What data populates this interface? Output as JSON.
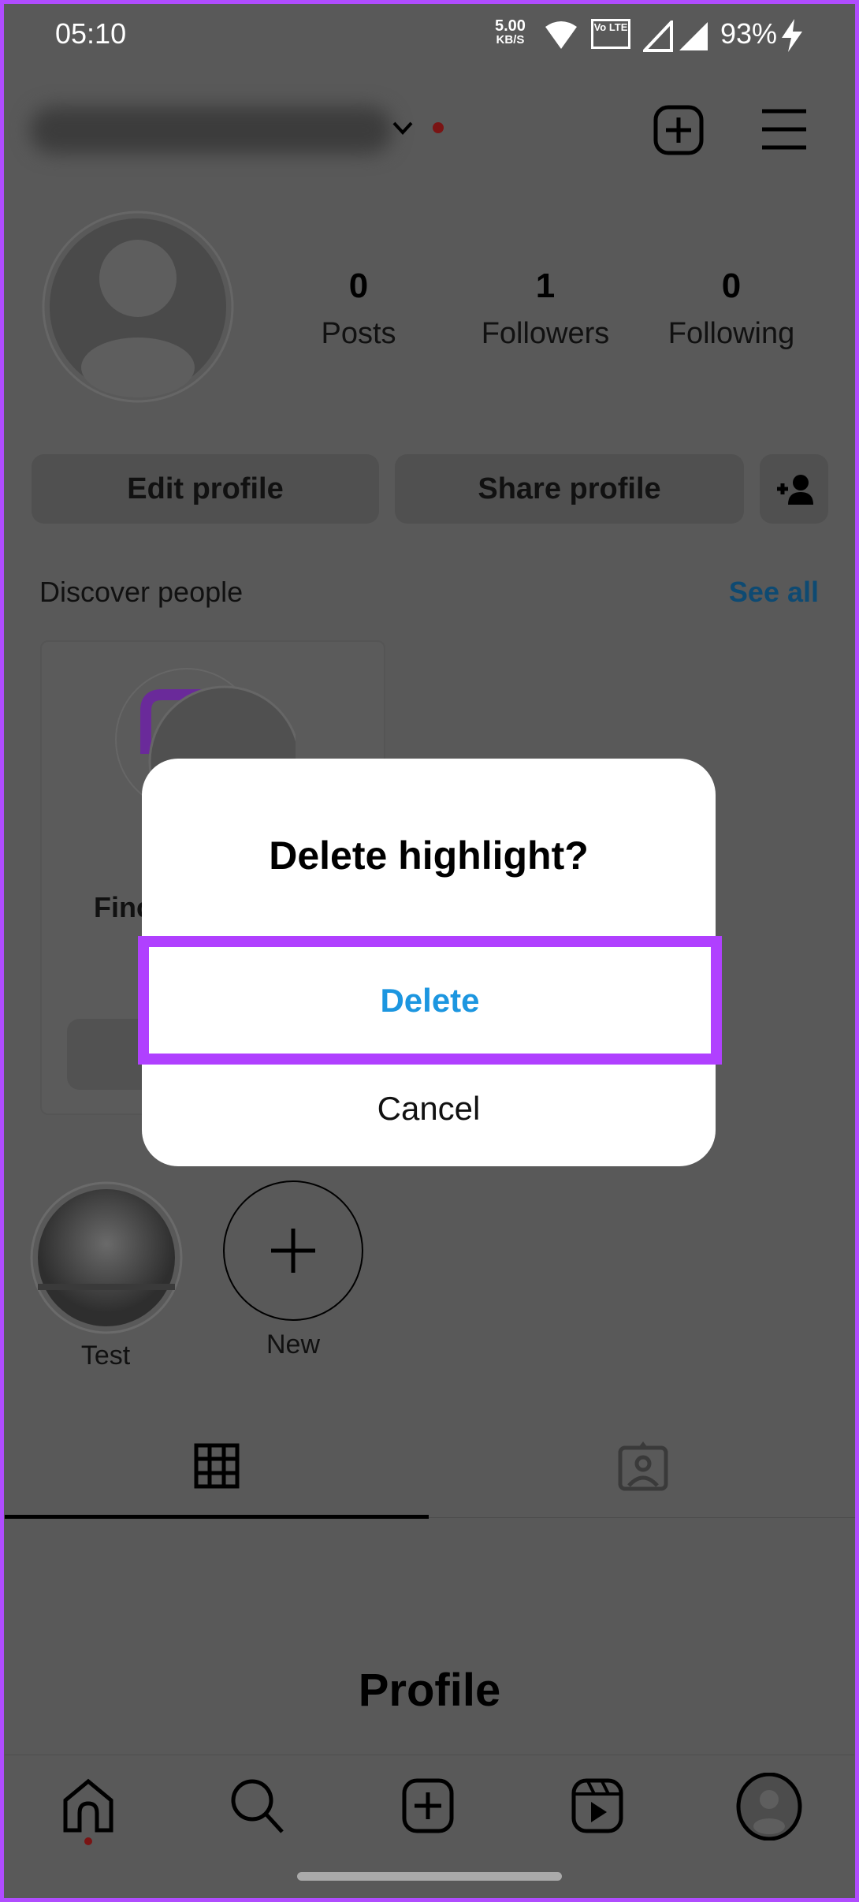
{
  "status_bar": {
    "time": "05:10",
    "net_speed": "5.00",
    "net_unit": "KB/S",
    "volte": "Vo LTE",
    "battery": "93%"
  },
  "header": {
    "username": "(blurred)"
  },
  "stats": [
    {
      "value": "0",
      "label": "Posts"
    },
    {
      "value": "1",
      "label": "Followers"
    },
    {
      "value": "0",
      "label": "Following"
    }
  ],
  "buttons": {
    "edit": "Edit profile",
    "share": "Share profile"
  },
  "discover": {
    "title": "Discover people",
    "see_all": "See all",
    "card_text_partial": "Finc"
  },
  "highlights": [
    {
      "label": "Test"
    },
    {
      "label": "New"
    }
  ],
  "empty_label": "Profile",
  "dialog": {
    "title": "Delete highlight?",
    "delete": "Delete",
    "cancel": "Cancel"
  },
  "colors": {
    "accent": "#1c96e0",
    "highlight_frame": "#b040ff",
    "dim_bg": "#595959"
  }
}
